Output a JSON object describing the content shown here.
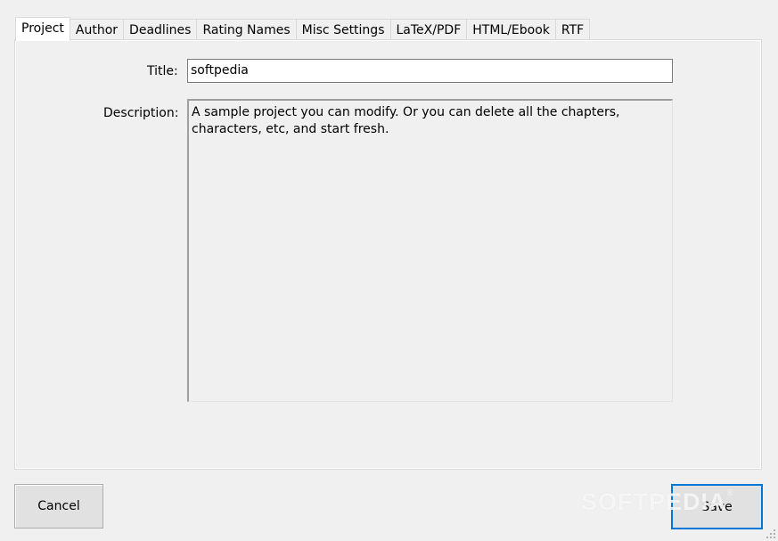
{
  "tabs": [
    {
      "label": "Project",
      "active": true
    },
    {
      "label": "Author",
      "active": false
    },
    {
      "label": "Deadlines",
      "active": false
    },
    {
      "label": "Rating Names",
      "active": false
    },
    {
      "label": "Misc Settings",
      "active": false
    },
    {
      "label": "LaTeX/PDF",
      "active": false
    },
    {
      "label": "HTML/Ebook",
      "active": false
    },
    {
      "label": "RTF",
      "active": false
    }
  ],
  "project": {
    "title_label": "Title:",
    "title_value": "softpedia",
    "description_label": "Description:",
    "description_value": "A sample project you can modify. Or you can delete all the chapters, characters, etc, and start fresh."
  },
  "buttons": {
    "cancel_label": "Cancel",
    "save_label": "Save"
  },
  "watermark": {
    "text": "SOFTPEDIA",
    "mark": "®"
  },
  "colors": {
    "window_bg": "#f0f0f0",
    "focus_border": "#0078d7",
    "button_bg": "#e1e1e1"
  },
  "icons": {
    "resize_grip": "resize-grip-icon"
  }
}
